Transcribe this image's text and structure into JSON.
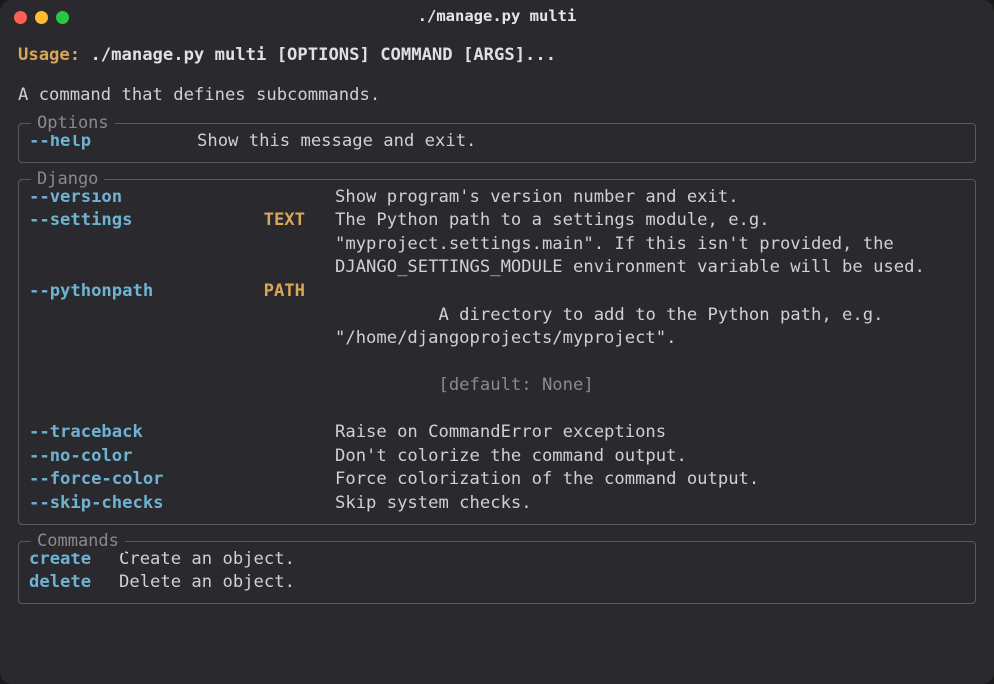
{
  "window": {
    "title": "./manage.py multi"
  },
  "usage": {
    "label": "Usage:",
    "args": "./manage.py multi [OPTIONS] COMMAND [ARGS]..."
  },
  "description": "A command that defines subcommands.",
  "options_panel": {
    "title": "Options",
    "items": [
      {
        "flag": "--help",
        "desc": "Show this message and exit."
      }
    ]
  },
  "django_panel": {
    "title": "Django",
    "items": [
      {
        "flag": "--version",
        "type": "",
        "desc": "Show program's version number and exit.",
        "default": ""
      },
      {
        "flag": "--settings",
        "type": "TEXT",
        "desc": "The Python path to a settings module, e.g. \"myproject.settings.main\". If this isn't provided, the DJANGO_SETTINGS_MODULE environment variable will be used.",
        "default": ""
      },
      {
        "flag": "--pythonpath",
        "type": "PATH",
        "desc": "A directory to add to the Python path, e.g. \"/home/djangoprojects/myproject\".",
        "default": "[default: None]"
      },
      {
        "flag": "--traceback",
        "type": "",
        "desc": "Raise on CommandError exceptions",
        "default": ""
      },
      {
        "flag": "--no-color",
        "type": "",
        "desc": "Don't colorize the command output.",
        "default": ""
      },
      {
        "flag": "--force-color",
        "type": "",
        "desc": "Force colorization of the command output.",
        "default": ""
      },
      {
        "flag": "--skip-checks",
        "type": "",
        "desc": "Skip system checks.",
        "default": ""
      }
    ]
  },
  "commands_panel": {
    "title": "Commands",
    "items": [
      {
        "name": "create",
        "desc": "Create an object."
      },
      {
        "name": "delete",
        "desc": "Delete an object."
      }
    ]
  }
}
